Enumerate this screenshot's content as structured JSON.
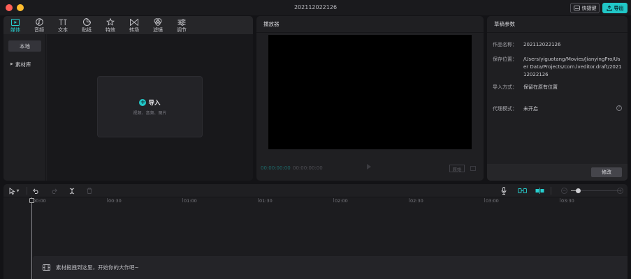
{
  "window": {
    "title": "202112022126"
  },
  "titlebar": {
    "shortcut_label": "快捷键",
    "export_label": "导出"
  },
  "media": {
    "tabs": [
      {
        "label": "媒体",
        "icon": "media-icon",
        "active": true
      },
      {
        "label": "音频",
        "icon": "audio-icon"
      },
      {
        "label": "文本",
        "icon": "text-icon"
      },
      {
        "label": "贴纸",
        "icon": "sticker-icon"
      },
      {
        "label": "特效",
        "icon": "effects-icon"
      },
      {
        "label": "转场",
        "icon": "transition-icon"
      },
      {
        "label": "滤镜",
        "icon": "filter-icon"
      },
      {
        "label": "调节",
        "icon": "adjust-icon"
      }
    ],
    "sidebar": {
      "local_label": "本地",
      "library_label": "素材库"
    },
    "import": {
      "label": "导入",
      "hint": "视频、音频、图片"
    }
  },
  "player": {
    "title": "播放器",
    "current_time": "00:00:00:00",
    "total_time": "00:00:00:00",
    "ratio_label": "原始"
  },
  "draft": {
    "title": "草稿参数",
    "rows": [
      {
        "key": "作品名称：",
        "value": "202112022126"
      },
      {
        "key": "保存位置：",
        "value": "/Users/yiguotang/Movies/JianyingPro/User Data/Projects/com.lveditor.draft/202112022126"
      },
      {
        "key": "导入方式：",
        "value": "保留在原有位置"
      },
      {
        "key": "代理模式：",
        "value": "未开启"
      }
    ],
    "edit_label": "修改"
  },
  "timeline": {
    "ruler_labels": [
      "00:00",
      "00:30",
      "01:00",
      "01:30",
      "02:00",
      "02:30",
      "03:00",
      "03:30"
    ],
    "drop_hint": "素材拖拽到这里，开始你的大作吧~"
  },
  "colors": {
    "accent": "#22c9c9",
    "panel": "#1f1f22",
    "background": "#131316"
  }
}
